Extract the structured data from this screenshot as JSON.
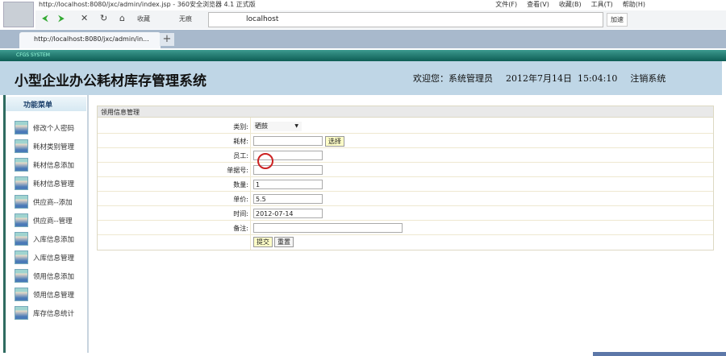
{
  "browser": {
    "window_title": "http://localhost:8080/jxc/admin/index.jsp - 360安全浏览器 4.1 正式版",
    "menus": [
      "文件(F)",
      "查看(V)",
      "收藏(B)",
      "工具(T)",
      "帮助(H)"
    ],
    "address": "localhost",
    "favorites": "收藏",
    "no_trace": "无痕",
    "speed": "加速",
    "tab_title": "http://localhost:8080/jxc/admin/in...",
    "new_tab": "+"
  },
  "strip_label": "CFGS SYSTEM",
  "header": {
    "title": "小型企业办公耗材库存管理系统",
    "welcome": "欢迎您：系统管理员",
    "datetime": "2012年7月14日  15:04:10",
    "logout": "注销系统"
  },
  "sidebar": {
    "title": "功能菜单",
    "items": [
      "修改个人密码",
      "耗材类别管理",
      "耗材信息添加",
      "耗材信息管理",
      "供应商--添加",
      "供应商--管理",
      "入库信息添加",
      "入库信息管理",
      "领用信息添加",
      "领用信息管理",
      "库存信息统计"
    ]
  },
  "form": {
    "title": "领用信息管理",
    "fields": [
      {
        "label": "类别:",
        "value": "硒鼓"
      },
      {
        "label": "耗材:",
        "value": ""
      },
      {
        "label": "员工:",
        "value": ""
      },
      {
        "label": "单据号:",
        "value": ""
      },
      {
        "label": "数量:",
        "value": "1"
      },
      {
        "label": "单价:",
        "value": "5.5"
      },
      {
        "label": "时间:",
        "value": "2012-07-14"
      },
      {
        "label": "备注:",
        "value": ""
      }
    ],
    "choose": "选择",
    "submit": "提交",
    "reset": "重置"
  }
}
